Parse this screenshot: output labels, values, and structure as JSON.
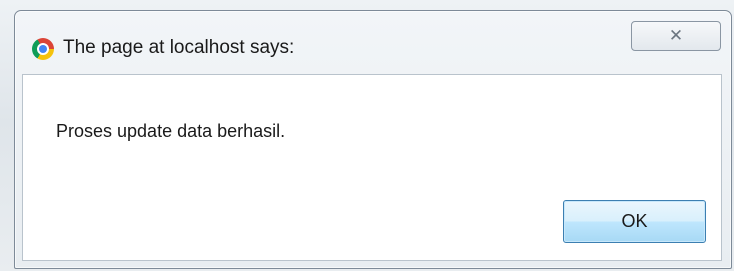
{
  "dialog": {
    "title": "The page at localhost says:",
    "close_label": "✕",
    "message": "Proses update data berhasil.",
    "ok_label": "OK",
    "icon": "chrome-icon"
  }
}
